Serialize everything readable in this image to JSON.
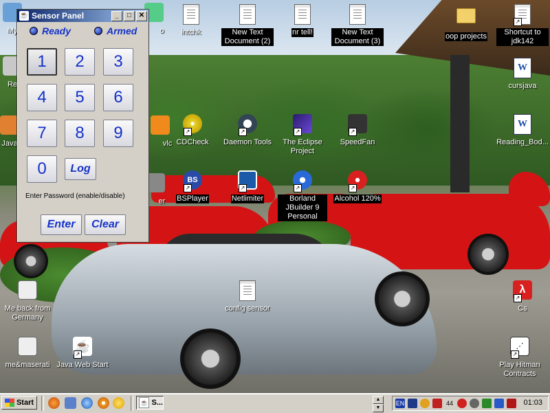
{
  "window": {
    "title": "Sensor Panel",
    "status": {
      "ready": "Ready",
      "armed": "Armed"
    },
    "keys": [
      "1",
      "2",
      "3",
      "4",
      "5",
      "6",
      "7",
      "8",
      "9",
      "0"
    ],
    "log_label": "Log",
    "hint": "Enter Password (enable/disable)",
    "enter_label": "Enter",
    "clear_label": "Clear"
  },
  "desktop_icons": {
    "intchk": "intchk",
    "ntd2": "New Text Document (2)",
    "nrtell": "nr tell!",
    "ntd3": "New Text Document (3)",
    "oop": "oop projects",
    "jdk": "Shortcut to jdk142",
    "cursjava": "cursjava",
    "cdcheck": "CDCheck",
    "daemon": "Daemon Tools",
    "eclipse": "The Eclipse Project",
    "speedfan": "SpeedFan",
    "reading": "Reading_Bod...",
    "bsplayer": "BSPlayer",
    "netlimiter": "Netlimiter",
    "jbuilder": "Borland JBuilder 9 Personal",
    "alcohol": "Alcohol 120%",
    "germany": "Me back from Germany",
    "config": "config sensor",
    "cs": "Cs",
    "maserati": "me&maserati",
    "javaweb": "Java Web Start",
    "hitman": "Play Hitman Contracts",
    "partial_my": "My",
    "partial_re": "Re",
    "partial_java": "Java",
    "partial_vlc": "vlc",
    "partial_o": "o",
    "partial_er": "er"
  },
  "taskbar": {
    "start_label": "Start",
    "task_label": "S...",
    "tray_lang": "EN",
    "tray_num": "44",
    "clock": "01:03"
  },
  "icons": {
    "minimize": "minimize-icon",
    "maximize": "maximize-icon",
    "close": "close-icon"
  }
}
